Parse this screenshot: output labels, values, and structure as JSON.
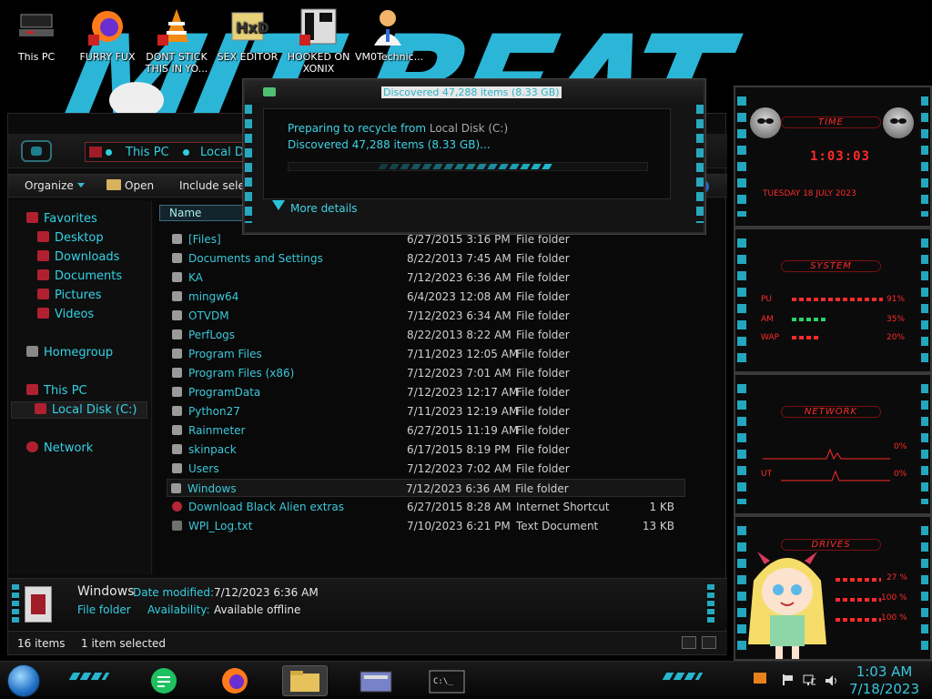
{
  "desktop": {
    "icons": [
      {
        "label": "This PC"
      },
      {
        "label": "FURRY FUX"
      },
      {
        "label": "DONT STICK THIS IN YO..."
      },
      {
        "label": "SEX EDITOR"
      },
      {
        "label": "HOOKED ON XONIX"
      },
      {
        "label": "VM0Technic..."
      }
    ]
  },
  "explorer": {
    "breadcrumb": [
      "This PC",
      "Local Dis"
    ],
    "toolbar": {
      "organize": "Organize",
      "open": "Open",
      "include": "Include select"
    },
    "help": "?",
    "nav": {
      "favorites": "Favorites",
      "desktop": "Desktop",
      "downloads": "Downloads",
      "documents": "Documents",
      "pictures": "Pictures",
      "videos": "Videos",
      "homegroup": "Homegroup",
      "this_pc": "This PC",
      "local_disk": "Local Disk (C:)",
      "network": "Network"
    },
    "columns": {
      "name": "Name"
    },
    "files": [
      {
        "name": "[Files]",
        "date": "6/27/2015 3:16 PM",
        "type": "File folder",
        "size": ""
      },
      {
        "name": "Documents and Settings",
        "date": "8/22/2013 7:45 AM",
        "type": "File folder",
        "size": ""
      },
      {
        "name": "KA",
        "date": "7/12/2023 6:36 AM",
        "type": "File folder",
        "size": ""
      },
      {
        "name": "mingw64",
        "date": "6/4/2023 12:08 AM",
        "type": "File folder",
        "size": ""
      },
      {
        "name": "OTVDM",
        "date": "7/12/2023 6:34 AM",
        "type": "File folder",
        "size": ""
      },
      {
        "name": "PerfLogs",
        "date": "8/22/2013 8:22 AM",
        "type": "File folder",
        "size": ""
      },
      {
        "name": "Program Files",
        "date": "7/11/2023 12:05 AM",
        "type": "File folder",
        "size": ""
      },
      {
        "name": "Program Files (x86)",
        "date": "7/12/2023 7:01 AM",
        "type": "File folder",
        "size": ""
      },
      {
        "name": "ProgramData",
        "date": "7/12/2023 12:17 AM",
        "type": "File folder",
        "size": ""
      },
      {
        "name": "Python27",
        "date": "7/11/2023 12:19 AM",
        "type": "File folder",
        "size": ""
      },
      {
        "name": "Rainmeter",
        "date": "6/27/2015 11:19 AM",
        "type": "File folder",
        "size": ""
      },
      {
        "name": "skinpack",
        "date": "6/17/2015 8:19 PM",
        "type": "File folder",
        "size": ""
      },
      {
        "name": "Users",
        "date": "7/12/2023 7:02 AM",
        "type": "File folder",
        "size": ""
      },
      {
        "name": "Windows",
        "date": "7/12/2023 6:36 AM",
        "type": "File folder",
        "size": ""
      },
      {
        "name": "Download Black Alien extras",
        "date": "6/27/2015 8:28 AM",
        "type": "Internet Shortcut",
        "size": "1 KB"
      },
      {
        "name": "WPI_Log.txt",
        "date": "7/10/2023 6:21 PM",
        "type": "Text Document",
        "size": "13 KB"
      }
    ],
    "details": {
      "name": "Windows",
      "date_label": "Date modified:",
      "date_value": "7/12/2023 6:36 AM",
      "type": "File folder",
      "avail_label": "Availability:",
      "avail_value": "Available offline"
    },
    "status": {
      "items": "16 items",
      "selected": "1 item selected"
    }
  },
  "dialog": {
    "title": "Discovered 47,288 items (8.33 GB)",
    "line1_prefix": "Preparing to recycle from ",
    "line1_source": "Local Disk (C:)",
    "line2": "Discovered 47,288 items (8.33 GB)...",
    "more_details": "More details"
  },
  "gadgets": {
    "time_title": "TIME",
    "time_value": "1:03:03",
    "date_value": "TUESDAY 18 JULY 2023",
    "system_title": "SYSTEM",
    "cpu_label": "PU",
    "cpu_value": "91%",
    "ram_label": "AM",
    "ram_value": "35%",
    "swap_label": "WAP",
    "swap_value": "20%",
    "network_title": "NETWORK",
    "net_in": "0%",
    "net_out_label": "UT",
    "net_out": "0%",
    "drives_title": "DRIVES",
    "drive1": "27 %",
    "drive2": "100 %",
    "drive3": "100 %"
  },
  "taskbar": {
    "time": "1:03 AM",
    "date": "7/18/2023"
  },
  "colors": {
    "accent": "#33d3e6",
    "gadget_red": "#ff2a2a"
  }
}
